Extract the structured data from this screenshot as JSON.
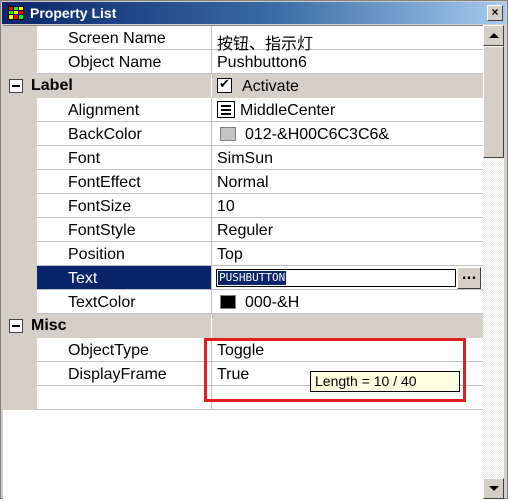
{
  "window": {
    "title": "Property List",
    "close_label": "×"
  },
  "rows": [
    {
      "name": "Screen Name",
      "value": "按钮、指示灯"
    },
    {
      "name": "Object Name",
      "value": "Pushbutton6"
    },
    {
      "category": "Label",
      "value": "Activate",
      "checked": true
    },
    {
      "name": "Alignment",
      "value": "MiddleCenter",
      "icon": "align-center-icon"
    },
    {
      "name": "BackColor",
      "value": "012-&H00C6C3C6&",
      "swatch": "#c6c3c6"
    },
    {
      "name": "Font",
      "value": "SimSun"
    },
    {
      "name": "FontEffect",
      "value": "Normal"
    },
    {
      "name": "FontSize",
      "value": "10"
    },
    {
      "name": "FontStyle",
      "value": "Reguler"
    },
    {
      "name": "Position",
      "value": "Top"
    },
    {
      "name": "Text",
      "value": "PUSHBUTTON",
      "selected": true,
      "button_label": "..."
    },
    {
      "name": "TextColor",
      "value": "000-&H",
      "swatch": "#000000"
    },
    {
      "category": "Misc"
    },
    {
      "name": "ObjectType",
      "value": "Toggle"
    },
    {
      "name": "DisplayFrame",
      "value": "True"
    }
  ],
  "tooltip": "Length = 10 / 40",
  "colors": {
    "titlebar": "#0a246a",
    "selection": "#0a246a",
    "highlight_box": "#e02020",
    "tooltip_bg": "#ffffe1"
  }
}
